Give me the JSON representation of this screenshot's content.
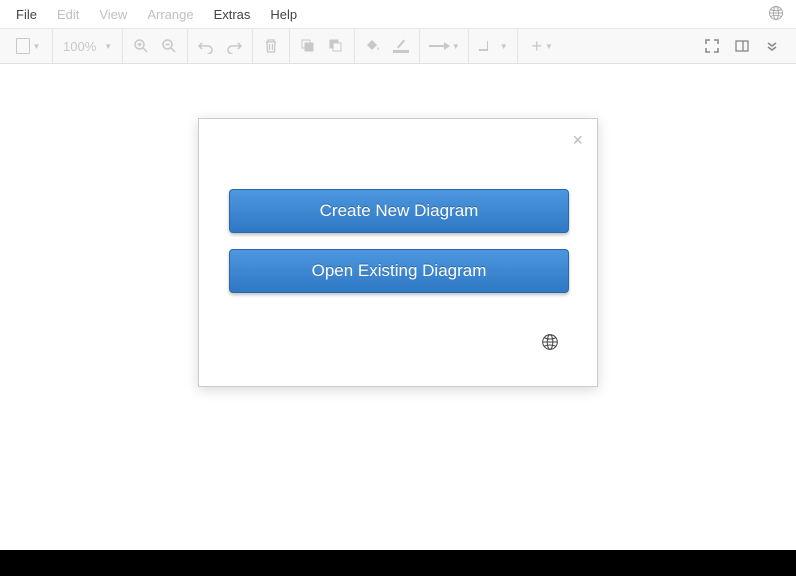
{
  "menubar": {
    "items": [
      {
        "label": "File",
        "enabled": true
      },
      {
        "label": "Edit",
        "enabled": false
      },
      {
        "label": "View",
        "enabled": false
      },
      {
        "label": "Arrange",
        "enabled": false
      },
      {
        "label": "Extras",
        "enabled": true
      },
      {
        "label": "Help",
        "enabled": true
      }
    ]
  },
  "toolbar": {
    "zoom": "100%"
  },
  "modal": {
    "create_label": "Create New Diagram",
    "open_label": "Open Existing Diagram"
  }
}
